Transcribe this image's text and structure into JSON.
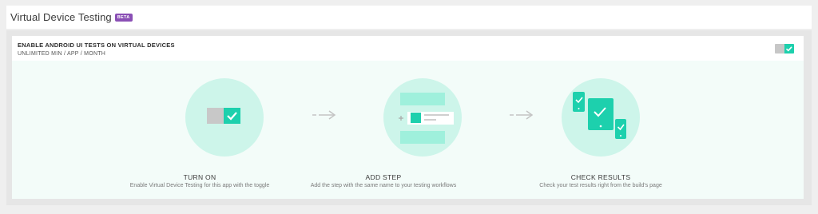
{
  "header": {
    "title": "Virtual Device Testing",
    "badge": "BETA"
  },
  "feature": {
    "title": "ENABLE ANDROID UI TESTS ON VIRTUAL DEVICES",
    "subtitle": "UNLIMITED MIN / APP / MONTH",
    "toggle_state": "on"
  },
  "steps": [
    {
      "icon": "toggle-illustration-icon",
      "title": "TURN ON",
      "description": "Enable Virtual Device Testing for this app with the toggle"
    },
    {
      "icon": "add-step-illustration-icon",
      "title": "ADD STEP",
      "description": "Add the step with the same name to your testing workflows"
    },
    {
      "icon": "devices-illustration-icon",
      "title": "CHECK RESULTS",
      "description": "Check your test results right from the build's page"
    }
  ],
  "colors": {
    "accent": "#1dd0ad",
    "accent_light": "#9ff0dc",
    "circle": "#cdf5ea",
    "badge": "#8a4fb5"
  }
}
